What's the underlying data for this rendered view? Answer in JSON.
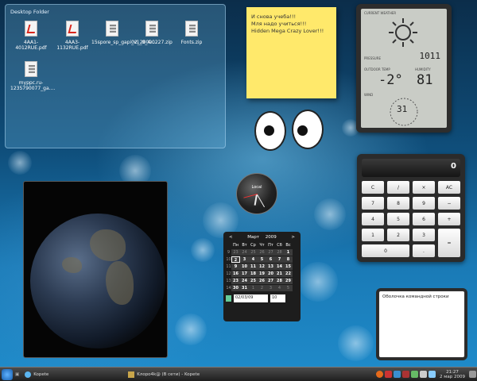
{
  "folder": {
    "title": "Desktop Folder",
    "files": [
      {
        "name": "4AA1-4012RUE.pdf",
        "type": "pdf"
      },
      {
        "name": "4AA3-1132RUE.pdf",
        "type": "pdf"
      },
      {
        "name": "15spore_sp_gapi_v1_0_4....",
        "type": "zip"
      },
      {
        "name": "02_20090227.zip",
        "type": "zip"
      },
      {
        "name": "Fonts.zip",
        "type": "zip"
      },
      {
        "name": "myppc.ru-1235790077_ga....",
        "type": "zip"
      }
    ]
  },
  "note": {
    "lines": [
      "И снова учеба!!!",
      "Мля надо учиться!!!",
      "Hidden Mega Crazy Lover!!!"
    ]
  },
  "weather": {
    "header": "CURRENT WEATHER",
    "pressure_label": "PRESSURE",
    "pressure": "1011",
    "temp_label": "OUTDOOR TEMP",
    "humidity_label": "HUMIDITY",
    "temp": "-2°",
    "humidity": "81",
    "wind_label": "WIND",
    "wind": "31"
  },
  "calculator": {
    "display": "0",
    "keys": [
      "C",
      "/",
      "×",
      "AC",
      "7",
      "8",
      "9",
      "−",
      "4",
      "5",
      "6",
      "+",
      "1",
      "2",
      "3",
      "=",
      "0",
      "."
    ]
  },
  "clock": {
    "label": "Local"
  },
  "calendar": {
    "month": "Март",
    "year": "2009",
    "prev": "<",
    "next": ">",
    "weekday_headers": [
      "Пн",
      "Вт",
      "Ср",
      "Чт",
      "Пт",
      "Сб",
      "Вс"
    ],
    "weeks": [
      {
        "week": "9",
        "days": [
          "23",
          "24",
          "25",
          "26",
          "27",
          "28",
          "1"
        ]
      },
      {
        "week": "10",
        "days": [
          "2",
          "3",
          "4",
          "5",
          "6",
          "7",
          "8"
        ]
      },
      {
        "week": "11",
        "days": [
          "9",
          "10",
          "11",
          "12",
          "13",
          "14",
          "15"
        ]
      },
      {
        "week": "12",
        "days": [
          "16",
          "17",
          "18",
          "19",
          "20",
          "21",
          "22"
        ]
      },
      {
        "week": "13",
        "days": [
          "23",
          "24",
          "25",
          "26",
          "27",
          "28",
          "29"
        ]
      },
      {
        "week": "14",
        "days": [
          "30",
          "31",
          "1",
          "2",
          "3",
          "4",
          "5"
        ]
      }
    ],
    "date_value": "02/03/09",
    "week_value": "10"
  },
  "terminal": {
    "title": "Оболочка командной строки"
  },
  "taskbar": {
    "app1": "Kopete",
    "app2": "Kлopo4k@ (В сети) - Kopete",
    "time": "21:27",
    "date": "2 мар 2009",
    "colors": {
      "kmenu": "#1860b0"
    }
  }
}
